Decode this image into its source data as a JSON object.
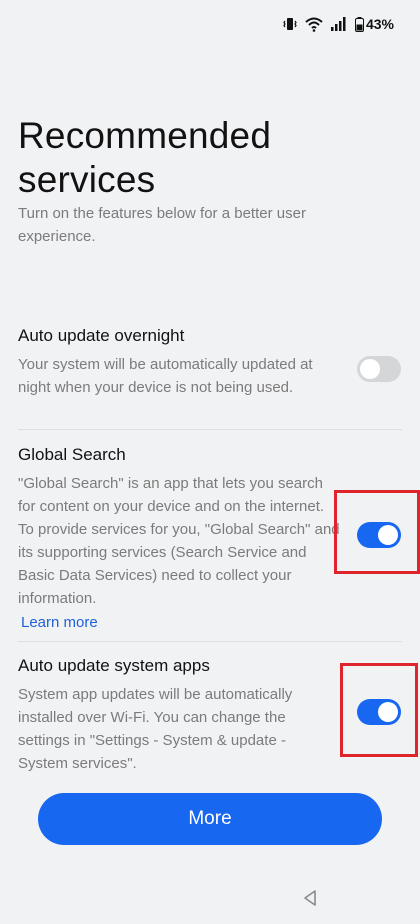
{
  "status_bar": {
    "battery_percent": "43%",
    "icons": [
      "vibrate-icon",
      "wifi-icon",
      "signal-icon",
      "battery-icon"
    ]
  },
  "page": {
    "title": "Recommended services",
    "subtitle": "Turn on the features below for a better user experience."
  },
  "services": [
    {
      "title": "Auto update overnight",
      "description": "Your system will be automatically updated at night when your device is not being used.",
      "enabled": false
    },
    {
      "title": "Global Search",
      "description": "\"Global Search\" is an app that lets you search for content on your device and on the internet. To provide services for you, \"Global Search\" and its supporting services (Search Service and Basic Data Services) need to collect your information.",
      "link_label": "Learn more",
      "enabled": true
    },
    {
      "title": "Auto update system apps",
      "description": "System app updates will be automatically installed over Wi-Fi. You can change the settings in \"Settings - System & update - System services\".",
      "enabled": true
    }
  ],
  "footer": {
    "more_label": "More"
  },
  "colors": {
    "accent": "#1767f0",
    "highlight": "#e0242c",
    "background": "#f1f2f4"
  }
}
